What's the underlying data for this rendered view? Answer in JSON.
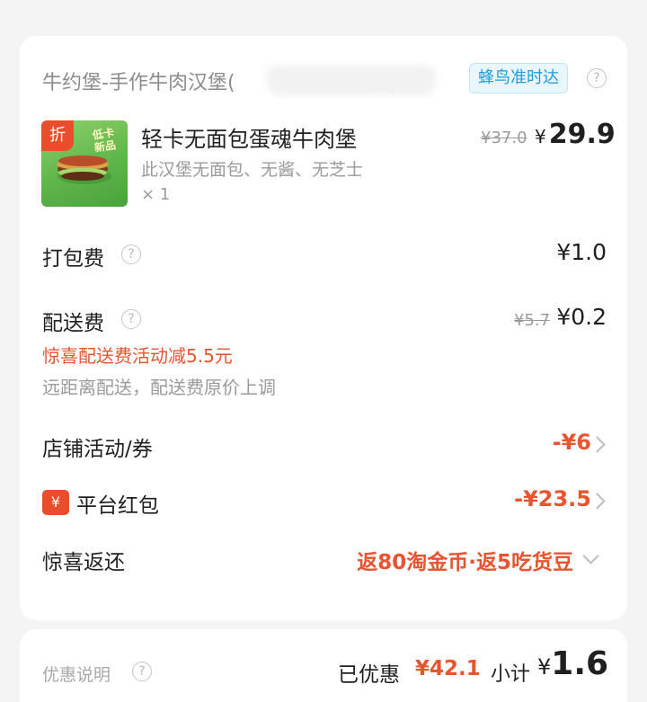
{
  "shop": {
    "name": "牛约堡-手作牛肉汉堡(",
    "name_tail": "店)",
    "delivery_badge": "蜂鸟准时达",
    "help_icon": "question-circle-icon"
  },
  "item": {
    "discount_tag": "折",
    "image_caption_top": "低卡",
    "image_caption_bottom": "新品",
    "title": "轻卡无面包蛋魂牛肉堡",
    "description": "此汉堡无面包、无酱、无芝士",
    "quantity": "× 1",
    "original_price": "¥37.0",
    "price_currency": "¥",
    "price": "29.9"
  },
  "packing_fee": {
    "label": "打包费",
    "help_icon": "question-circle-icon",
    "amount": "¥1.0"
  },
  "delivery_fee": {
    "label": "配送费",
    "help_icon": "question-circle-icon",
    "original": "¥5.7",
    "amount": "¥0.2",
    "promo": "惊喜配送费活动减5.5元",
    "note": "远距离配送，配送费原价上调"
  },
  "store_discount": {
    "label": "店铺活动/券",
    "amount": "-¥6",
    "icon": "chevron-right-icon"
  },
  "platform_redpacket": {
    "badge_icon": "yuan-icon",
    "badge_text": "¥",
    "label": "平台红包",
    "amount": "-¥23.5",
    "icon": "chevron-right-icon"
  },
  "surprise_return": {
    "label": "惊喜返还",
    "value": "返80淘金币·返5吃货豆",
    "icon": "chevron-down-icon"
  },
  "footer": {
    "discount_info_label": "优惠说明",
    "help_icon": "question-circle-icon",
    "saved_label": "已优惠",
    "saved_amount": "¥42.1",
    "subtotal_label": "小计",
    "subtotal_currency": "¥",
    "subtotal_amount": "1.6"
  },
  "colors": {
    "accent_red": "#e8542f",
    "badge_blue": "#1b9cd8",
    "badge_blue_bg": "#e9f6fd",
    "muted_text": "#9a9a9a"
  }
}
